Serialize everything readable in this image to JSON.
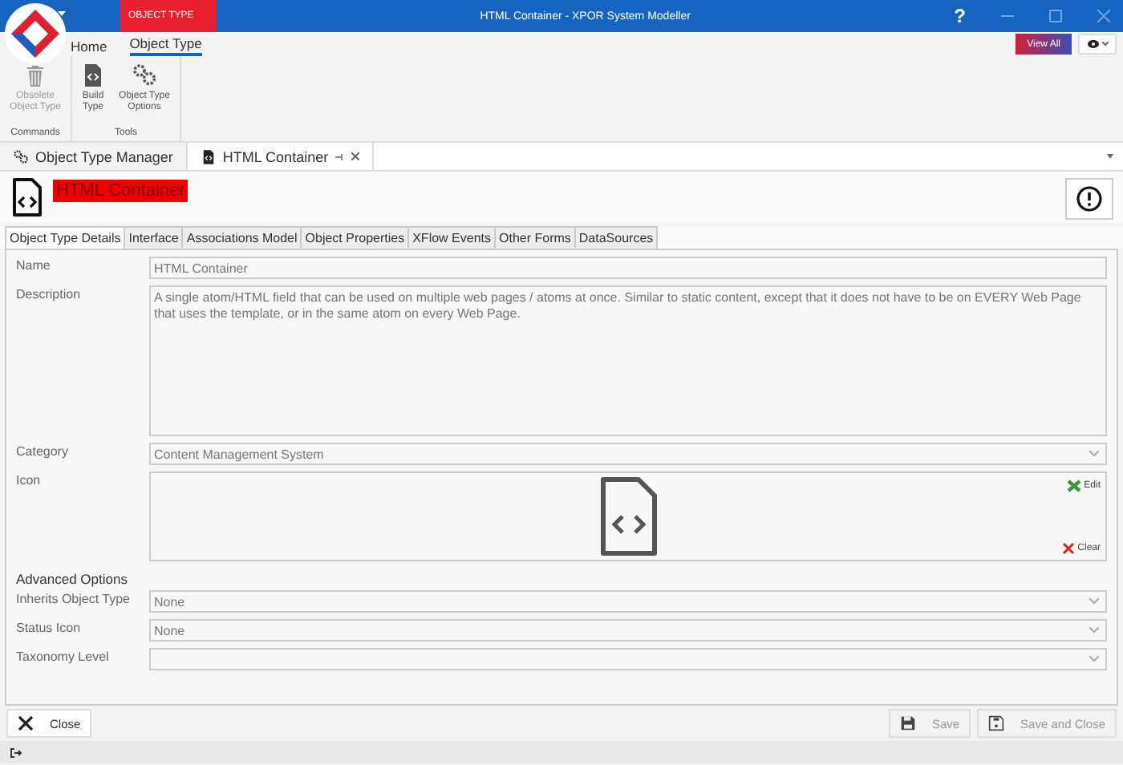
{
  "title_bar": {
    "context_tab": "OBJECT TYPE",
    "title": "HTML Container - XPOR System Modeller",
    "help": "?"
  },
  "ribbon": {
    "tabs": [
      {
        "label": "Home",
        "selected": false
      },
      {
        "label": "Object Type",
        "selected": true
      }
    ],
    "groups": [
      {
        "label": "Commands",
        "items": [
          {
            "label": "Obsolete Object Type",
            "kind": "trash",
            "disabled": true
          }
        ]
      },
      {
        "label": "Tools",
        "items": [
          {
            "label": "Build Type",
            "kind": "file-code",
            "disabled": false
          },
          {
            "label": "Object Type Options",
            "kind": "gears",
            "disabled": false
          }
        ]
      }
    ],
    "view_all": "View All"
  },
  "document_tabs": [
    {
      "label": "Object Type Manager",
      "kind": "gears",
      "selected": false
    },
    {
      "label": "HTML Container",
      "kind": "file-code",
      "selected": true
    }
  ],
  "header": {
    "title": "HTML Container"
  },
  "form_tabs": [
    {
      "label": "Object Type Details",
      "selected": true
    },
    {
      "label": "Interface",
      "selected": false
    },
    {
      "label": "Associations Model",
      "selected": false
    },
    {
      "label": "Object Properties",
      "selected": false
    },
    {
      "label": "XFlow Events",
      "selected": false
    },
    {
      "label": "Other Forms",
      "selected": false
    },
    {
      "label": "DataSources",
      "selected": false
    }
  ],
  "fields": [
    {
      "label": "Name",
      "kind": "text",
      "value": "HTML Container"
    },
    {
      "label": "Description",
      "kind": "memo",
      "value": "A single atom/HTML field that can be used on multiple web pages / atoms at once. Similar to static content, except that it does not have to be on EVERY Web Page that uses the template, or in the same atom on every Web Page."
    },
    {
      "label": "Category",
      "kind": "dropdown",
      "value": "Content Management System"
    },
    {
      "label": "Icon",
      "kind": "image",
      "edit": "Edit",
      "clear": "Clear"
    }
  ],
  "advanced": {
    "title": "Advanced Options",
    "fields": [
      {
        "label": "Inherits Object Type",
        "kind": "dropdown",
        "value": "None"
      },
      {
        "label": "Status Icon",
        "kind": "dropdown",
        "value": "None"
      },
      {
        "label": "Taxonomy Level",
        "kind": "dropdown"
      }
    ]
  },
  "footer": {
    "buttons": [
      {
        "label": "Close",
        "kind": "close",
        "disabled": false
      },
      {
        "label": "Save",
        "kind": "save",
        "disabled": true
      },
      {
        "label": "Save and Close",
        "kind": "save-close",
        "disabled": true
      }
    ]
  }
}
